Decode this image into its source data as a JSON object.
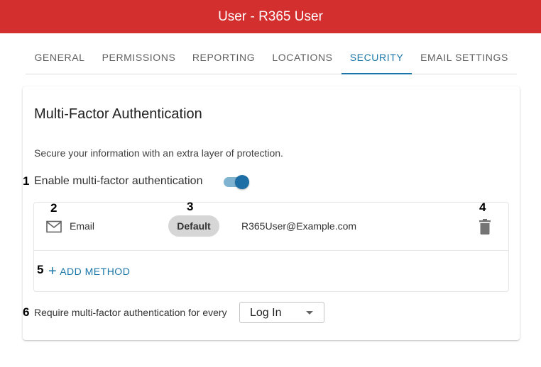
{
  "window": {
    "title": "User - R365 User"
  },
  "tabs": [
    {
      "label": "GENERAL",
      "active": false
    },
    {
      "label": "PERMISSIONS",
      "active": false
    },
    {
      "label": "REPORTING",
      "active": false
    },
    {
      "label": "LOCATIONS",
      "active": false
    },
    {
      "label": "SECURITY",
      "active": true
    },
    {
      "label": "EMAIL SETTINGS",
      "active": false
    }
  ],
  "mfa": {
    "title": "Multi-Factor Authentication",
    "description": "Secure your information with an extra layer of protection.",
    "enable_label": "Enable multi-factor authentication",
    "enabled": true,
    "methods": [
      {
        "icon": "mail-icon",
        "type": "Email",
        "badge": "Default",
        "value": "R365User@Example.com",
        "action_icon": "trash-icon"
      }
    ],
    "add_method_label": "ADD METHOD",
    "require_label": "Require multi-factor authentication for every",
    "require_value": "Log In"
  },
  "markers": [
    "1",
    "2",
    "3",
    "4",
    "5",
    "6"
  ],
  "colors": {
    "header": "#d32f2f",
    "accent": "#1976a8",
    "toggle_thumb": "#1c6ea4",
    "toggle_track": "#7fb3d0",
    "chip": "#d6d6d6"
  }
}
